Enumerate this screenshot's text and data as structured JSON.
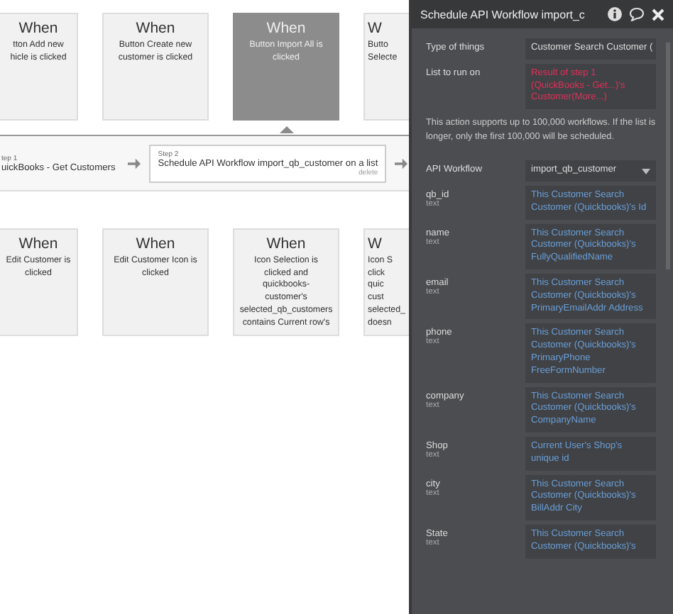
{
  "top_events": [
    {
      "heading": "When",
      "lines": [
        "tton Add new",
        "hicle is clicked"
      ],
      "selected": false
    },
    {
      "heading": "When",
      "lines": [
        "Button Create new",
        "customer is clicked"
      ],
      "selected": false
    },
    {
      "heading": "When",
      "lines": [
        "Button Import All is",
        "clicked"
      ],
      "selected": true
    },
    {
      "heading": "W",
      "lines": [
        "Butto",
        "Selecte"
      ],
      "selected": false
    }
  ],
  "steps": [
    {
      "label": "tep 1",
      "action": "uickBooks - Get Customers",
      "selected": false
    },
    {
      "label": "Step 2",
      "action": "Schedule API Workflow import_qb_customer on a list",
      "selected": true,
      "delete": "delete"
    }
  ],
  "bottom_events": [
    {
      "heading": "When",
      "lines": [
        "Edit Customer is",
        "clicked"
      ],
      "selected": false
    },
    {
      "heading": "When",
      "lines": [
        "Edit Customer Icon is",
        "clicked"
      ],
      "selected": false
    },
    {
      "heading": "When",
      "lines": [
        "Icon Selection is",
        "clicked and",
        "quickbooks-",
        "customer's",
        "selected_qb_customers",
        "contains Current row's"
      ],
      "selected": false
    },
    {
      "heading": "W",
      "lines": [
        "Icon S",
        "click",
        "quic",
        "cust",
        "selected_",
        "doesn"
      ],
      "selected": false
    }
  ],
  "panel": {
    "title": "Schedule API Workflow import_c",
    "fields": [
      {
        "label": "Type of things",
        "kind": "static",
        "value": "Customer Search Customer ("
      },
      {
        "label": "List to run on",
        "kind": "error",
        "value": "Result of step 1 (QuickBooks - Get...)'s Customer(More...)"
      },
      {
        "kind": "note",
        "value": "This action supports up to 100,000 workflows. If the list is longer, only the first 100,000 will be scheduled."
      },
      {
        "label": "API Workflow",
        "kind": "dropdown",
        "value": "import_qb_customer"
      },
      {
        "label": "qb_id",
        "type": "text",
        "kind": "expression",
        "value": "This Customer Search Customer (Quickbooks)'s Id"
      },
      {
        "label": "name",
        "type": "text",
        "kind": "expression",
        "value": "This Customer Search Customer (Quickbooks)'s FullyQualifiedName"
      },
      {
        "label": "email",
        "type": "text",
        "kind": "expression",
        "value": "This Customer Search Customer (Quickbooks)'s PrimaryEmailAddr Address"
      },
      {
        "label": "phone",
        "type": "text",
        "kind": "expression",
        "value": "This Customer Search Customer (Quickbooks)'s PrimaryPhone FreeFormNumber"
      },
      {
        "label": "company",
        "type": "text",
        "kind": "expression",
        "value": "This Customer Search Customer (Quickbooks)'s CompanyName"
      },
      {
        "label": "Shop",
        "type": "text",
        "kind": "expression",
        "value": "Current User's Shop's unique id"
      },
      {
        "label": "city",
        "type": "text",
        "kind": "expression",
        "value": "This Customer Search Customer (Quickbooks)'s BillAddr City"
      },
      {
        "label": "State",
        "type": "text",
        "kind": "expression",
        "value": "This Customer Search Customer (Quickbooks)'s"
      }
    ]
  }
}
